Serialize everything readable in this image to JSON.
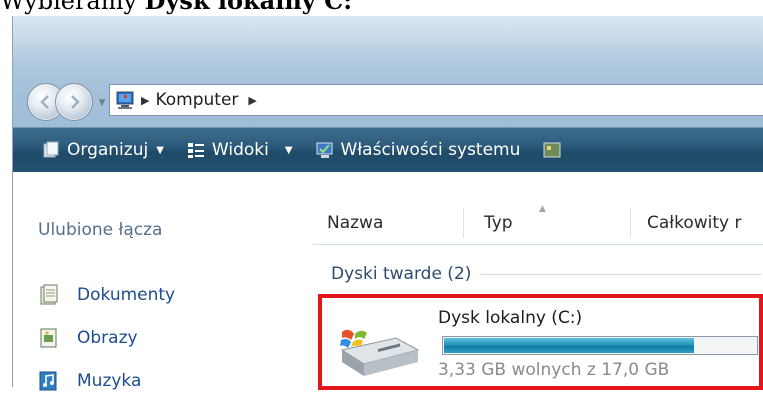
{
  "caption": {
    "prefix": "Wybieramy ",
    "bold": "Dysk lokalny C:"
  },
  "address_bar": {
    "location": "Komputer"
  },
  "toolbar": {
    "organize": "Organizuj",
    "views": "Widoki",
    "system_properties": "Właściwości systemu"
  },
  "sidebar": {
    "title": "Ulubione łącza",
    "items": [
      {
        "label": "Dokumenty",
        "icon": "documents-icon"
      },
      {
        "label": "Obrazy",
        "icon": "pictures-icon"
      },
      {
        "label": "Muzyka",
        "icon": "music-icon"
      }
    ]
  },
  "columns": [
    "Nazwa",
    "Typ",
    "Całkowity r"
  ],
  "group": {
    "label": "Dyski twarde (2)"
  },
  "drive": {
    "name": "Dysk lokalny (C:)",
    "free_text": "3,33 GB wolnych z 17,0 GB",
    "used_fraction": 0.804,
    "highlight_color": "#e4141b"
  },
  "colors": {
    "toolbar_bg": "#23506f",
    "link": "#1c4d8e",
    "bar_fill": "#2596bd"
  }
}
